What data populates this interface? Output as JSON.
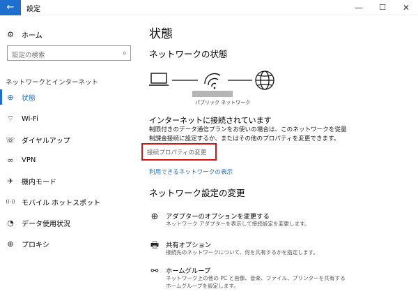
{
  "window": {
    "title": "設定",
    "back_icon": "←",
    "minimize": "—",
    "maximize": "☐",
    "close": "✕"
  },
  "sidebar": {
    "home": {
      "label": "ホーム",
      "icon": "gear-icon",
      "glyph": "⚙"
    },
    "search": {
      "placeholder": "設定の検索",
      "icon_glyph": "⌕"
    },
    "section_label": "ネットワークとインターネット",
    "items": [
      {
        "label": "状態",
        "icon": "globe-icon",
        "glyph": "⊕",
        "active": true
      },
      {
        "label": "Wi-Fi",
        "icon": "wifi-icon",
        "glyph": "⌔",
        "active": false
      },
      {
        "label": "ダイヤルアップ",
        "icon": "dialup-icon",
        "glyph": "☏",
        "active": false
      },
      {
        "label": "VPN",
        "icon": "vpn-icon",
        "glyph": "∞",
        "active": false
      },
      {
        "label": "機内モード",
        "icon": "airplane-icon",
        "glyph": "✈",
        "active": false
      },
      {
        "label": "モバイル ホットスポット",
        "icon": "hotspot-icon",
        "glyph": "((·))",
        "active": false
      },
      {
        "label": "データ使用状況",
        "icon": "data-usage-icon",
        "glyph": "◔",
        "active": false
      },
      {
        "label": "プロキシ",
        "icon": "proxy-icon",
        "glyph": "⊕",
        "active": false
      }
    ]
  },
  "main": {
    "title": "状態",
    "network_status_heading": "ネットワークの状態",
    "network_caption": "パブリック ネットワーク",
    "status_heading": "インターネットに接続されています",
    "description_lines": [
      "制限付きのデータ通信プランをお使いの場合は、このネットワークを従量",
      "制課金接続に設定するか、またはその他のプロパティを変更できます。"
    ],
    "change_properties_link": "接続プロパティの変更",
    "show_networks_link": "利用できるネットワークの表示",
    "settings_heading": "ネットワーク設定の変更",
    "options": [
      {
        "title": "アダプターのオプションを変更する",
        "desc": [
          "ネットワーク アダプターを表示して接続設定を変更します。"
        ],
        "icon": "adapter-icon",
        "glyph": "⊕"
      },
      {
        "title": "共有オプション",
        "desc": [
          "接続先のネットワークについて、何を共有するかを指定します。"
        ],
        "icon": "sharing-icon",
        "glyph": "🖶"
      },
      {
        "title": "ホームグループ",
        "desc": [
          "ネットワーク上の他の PC と画像、音楽、ファイル、プリンターを共有する",
          "ホームグループを設定します。"
        ],
        "icon": "homegroup-icon",
        "glyph": "⚯"
      }
    ]
  },
  "colors": {
    "accent": "#1f6fcf",
    "highlight_box": "#e01010"
  }
}
